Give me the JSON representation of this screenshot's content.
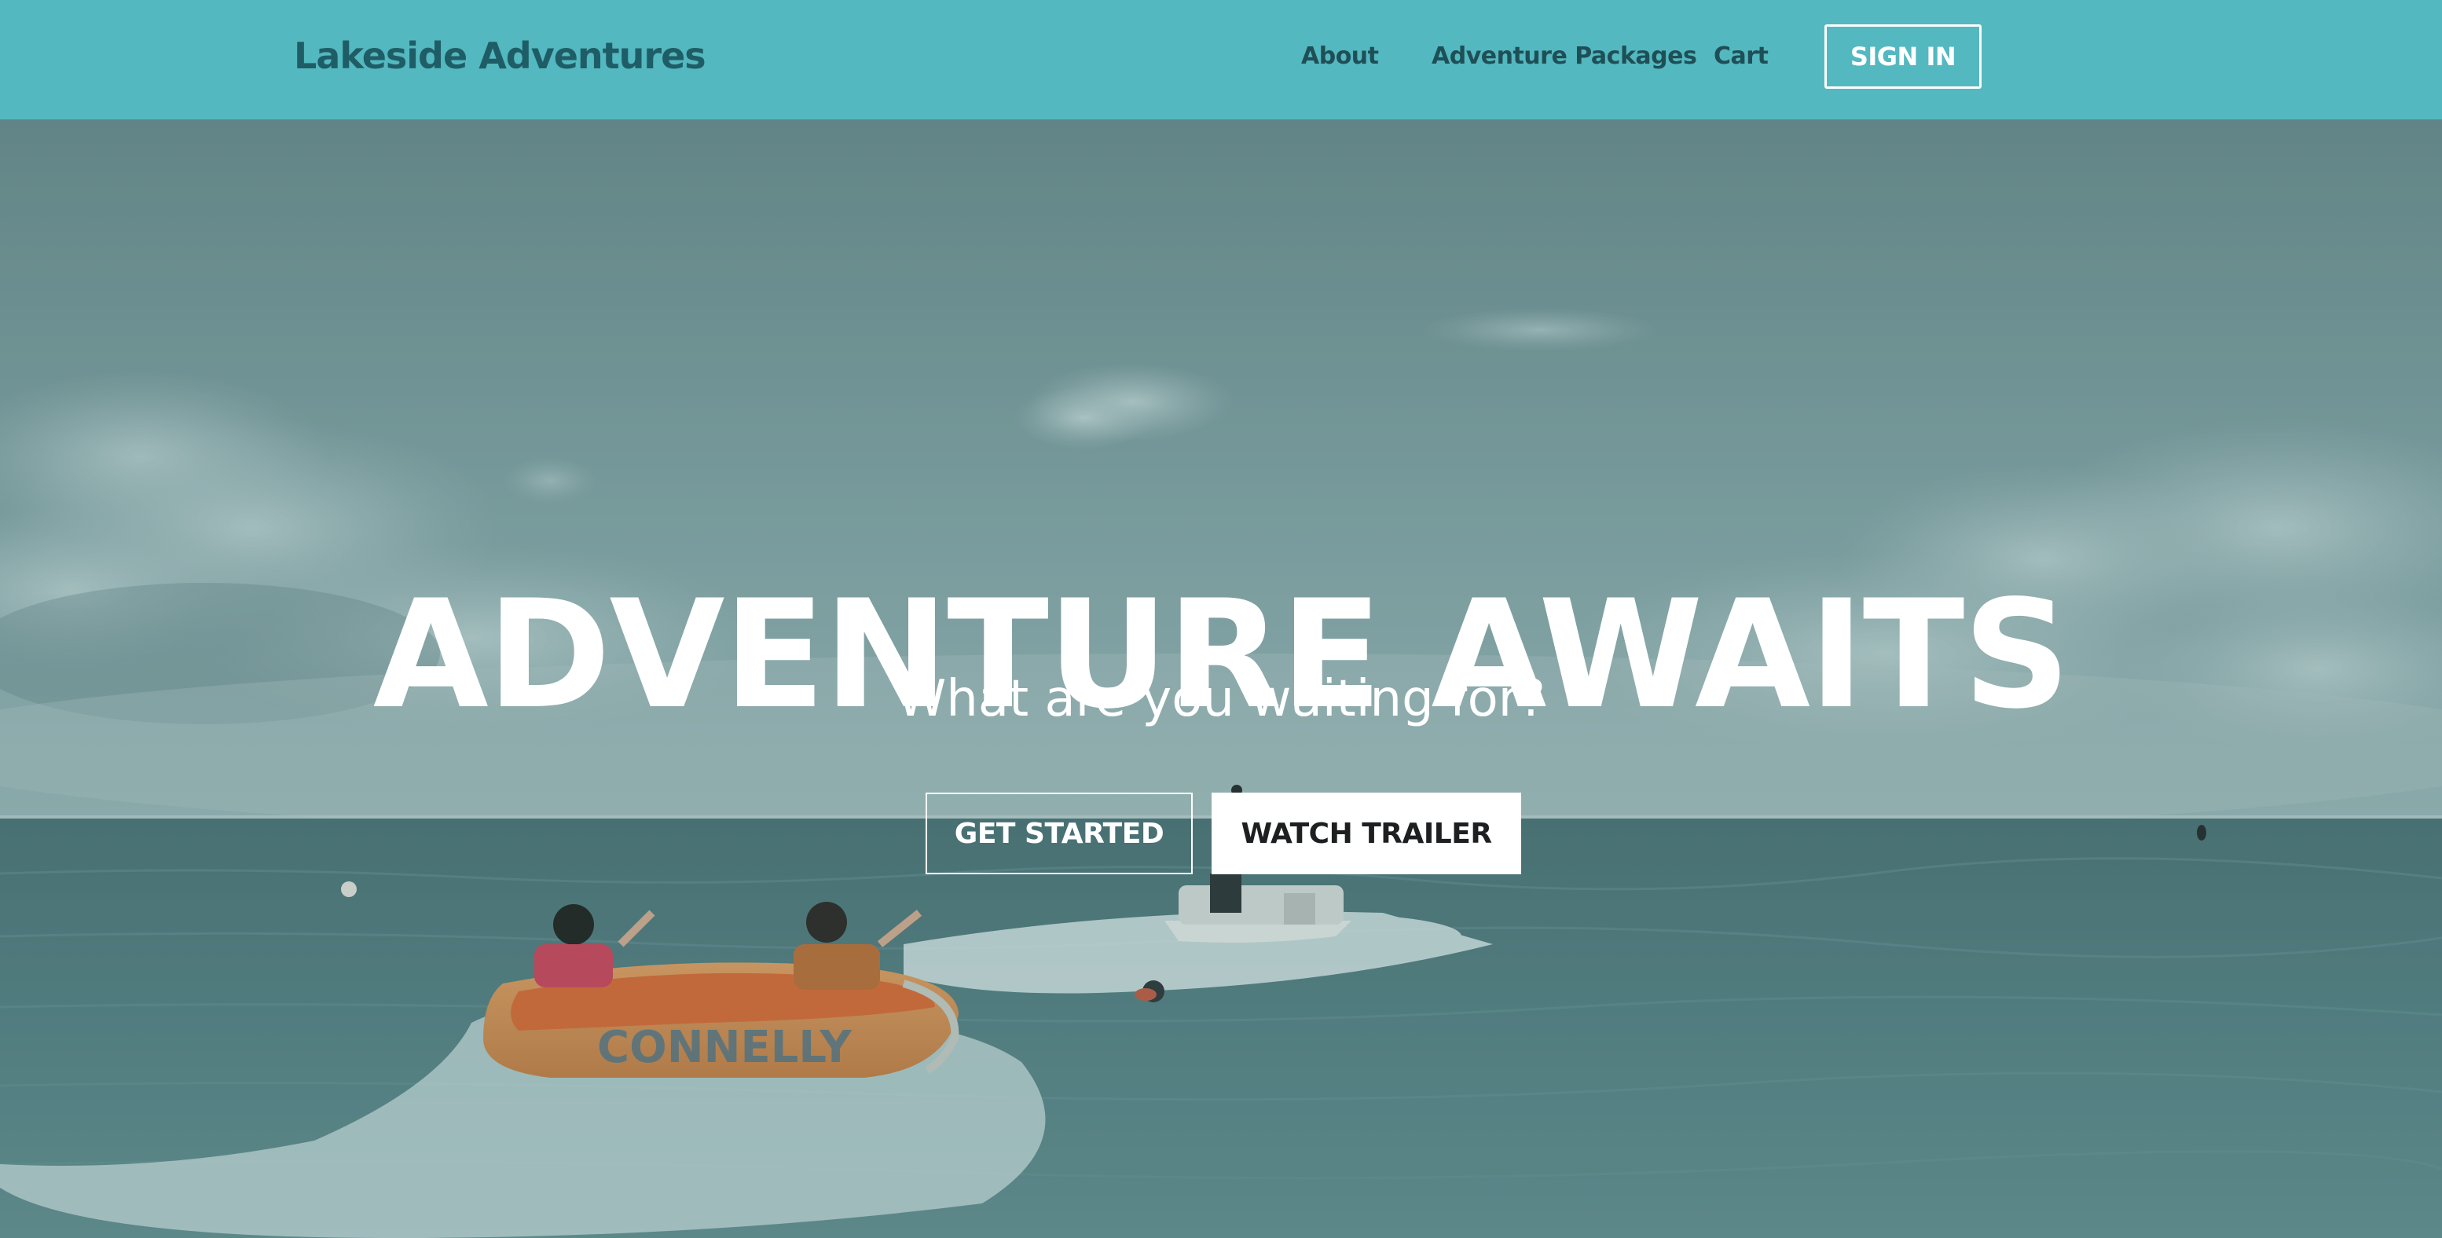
{
  "nav": {
    "brand": "Lakeside Adventures",
    "links": [
      "About",
      "Adventure Packages",
      "Cart"
    ],
    "sign_in": "SIGN IN"
  },
  "hero": {
    "title": "ADVENTURE AWAITS",
    "subtitle": "What are you waiting for?",
    "primary_button": "GET STARTED",
    "secondary_button": "WATCH TRAILER",
    "tube_brand": "CONNELLY"
  },
  "colors": {
    "nav_background": "#53b8c0",
    "brand_text": "#1f5d66",
    "nav_link": "#1f4f56",
    "hero_overlay": "#5f8a8c",
    "sky": "#7d9c9e",
    "water": "#4e7376",
    "button_text_dark": "#1d1f20"
  },
  "icons": {
    "hero_image": "lake-tubing-photo"
  }
}
